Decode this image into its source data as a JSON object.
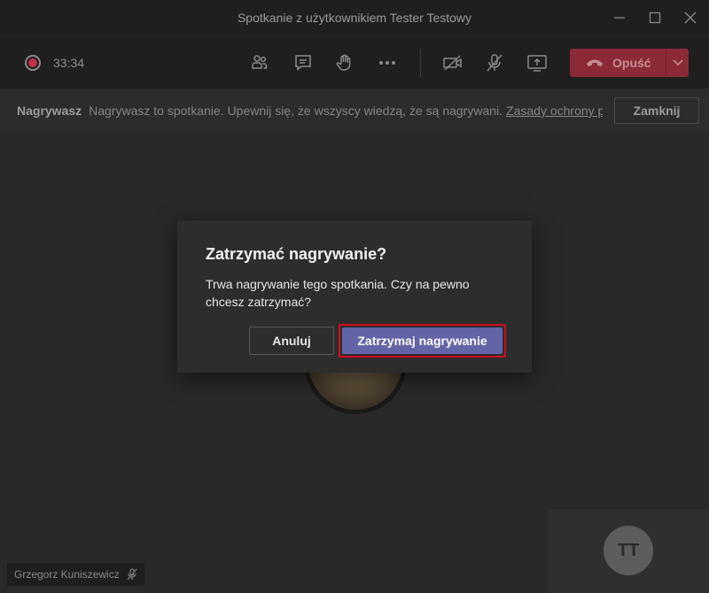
{
  "window": {
    "title": "Spotkanie z użytkownikiem Tester Testowy"
  },
  "toolbar": {
    "timer": "33:34",
    "leave_label": "Opuść"
  },
  "banner": {
    "bold_label": "Nagrywasz",
    "message": "Nagrywasz to spotkanie. Upewnij się, że wszyscy wiedzą, że są nagrywani.",
    "link_text": "Zasady ochrony prywatności",
    "close_label": "Zamknij"
  },
  "dialog": {
    "title": "Zatrzymać nagrywanie?",
    "body": "Trwa nagrywanie tego spotkania. Czy na pewno chcesz zatrzymać?",
    "cancel_label": "Anuluj",
    "confirm_label": "Zatrzymaj nagrywanie"
  },
  "participants": {
    "main_name": "Grzegorz Kuniszewicz",
    "self_initials": "TT"
  },
  "colors": {
    "accent": "#6264a7",
    "leave": "#8b2a36",
    "recording": "#c4314b",
    "highlight": "#d10b1f"
  }
}
